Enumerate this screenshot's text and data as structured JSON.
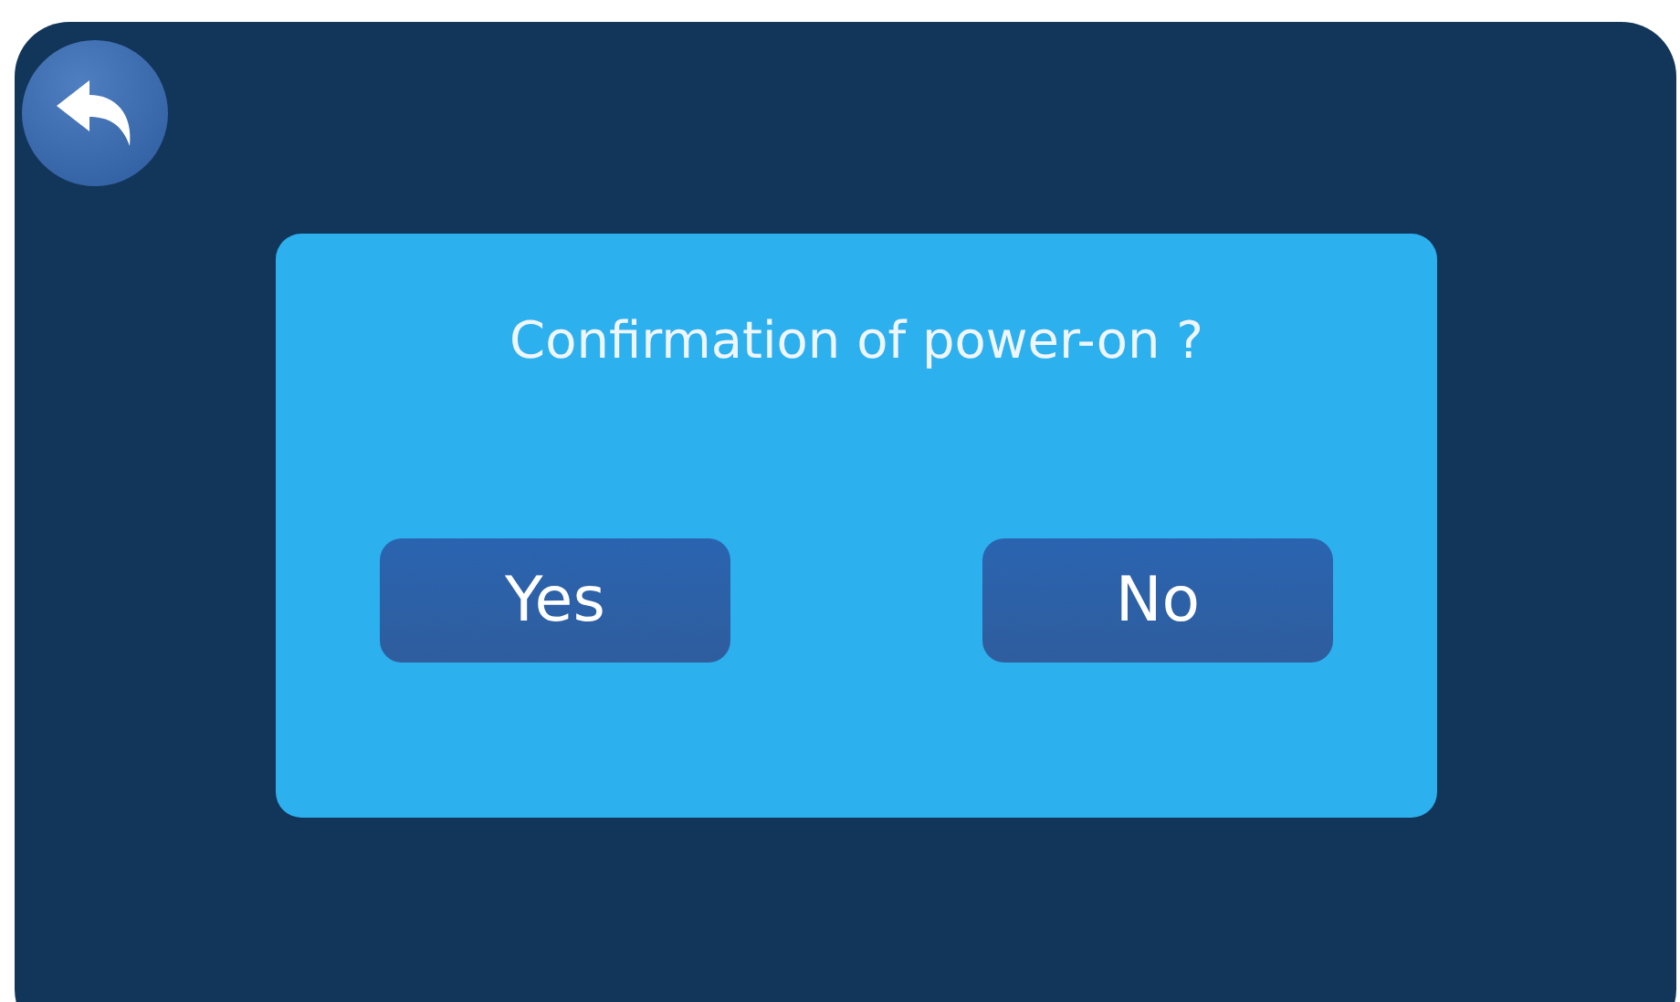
{
  "back_button": {
    "kind": "back"
  },
  "dialog": {
    "message": "Confirmation of power-on ?",
    "buttons": [
      "Yes",
      "No"
    ]
  }
}
